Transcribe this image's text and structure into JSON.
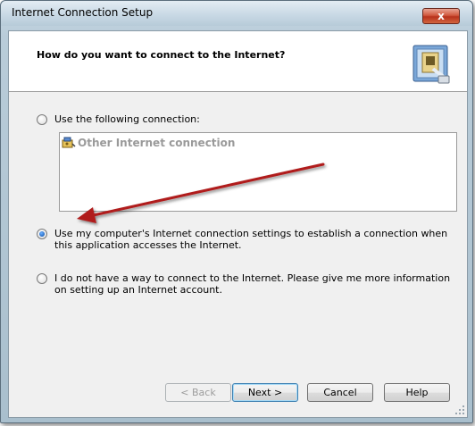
{
  "window": {
    "title": "Internet Connection Setup",
    "close_label": "x"
  },
  "header": {
    "title": "How do you want to connect to the Internet?",
    "icon": "network-plug-icon"
  },
  "options": {
    "use_connection": {
      "label": "Use the following connection:",
      "checked": false
    },
    "use_computer_settings": {
      "label": "Use my computer's Internet connection settings to establish a connection when this application accesses the Internet.",
      "checked": true
    },
    "no_way": {
      "label": "I do not have a way to connect to the Internet.  Please give me more information on setting up an Internet account.",
      "checked": false
    }
  },
  "connection_list": {
    "items": [
      {
        "label": "Other Internet connection",
        "icon": "connection-icon"
      }
    ]
  },
  "buttons": {
    "back": "< Back",
    "next": "Next >",
    "cancel": "Cancel",
    "help": "Help"
  },
  "colors": {
    "annotation_arrow": "#b01c1c",
    "disabled_text": "#9a9a9a"
  }
}
